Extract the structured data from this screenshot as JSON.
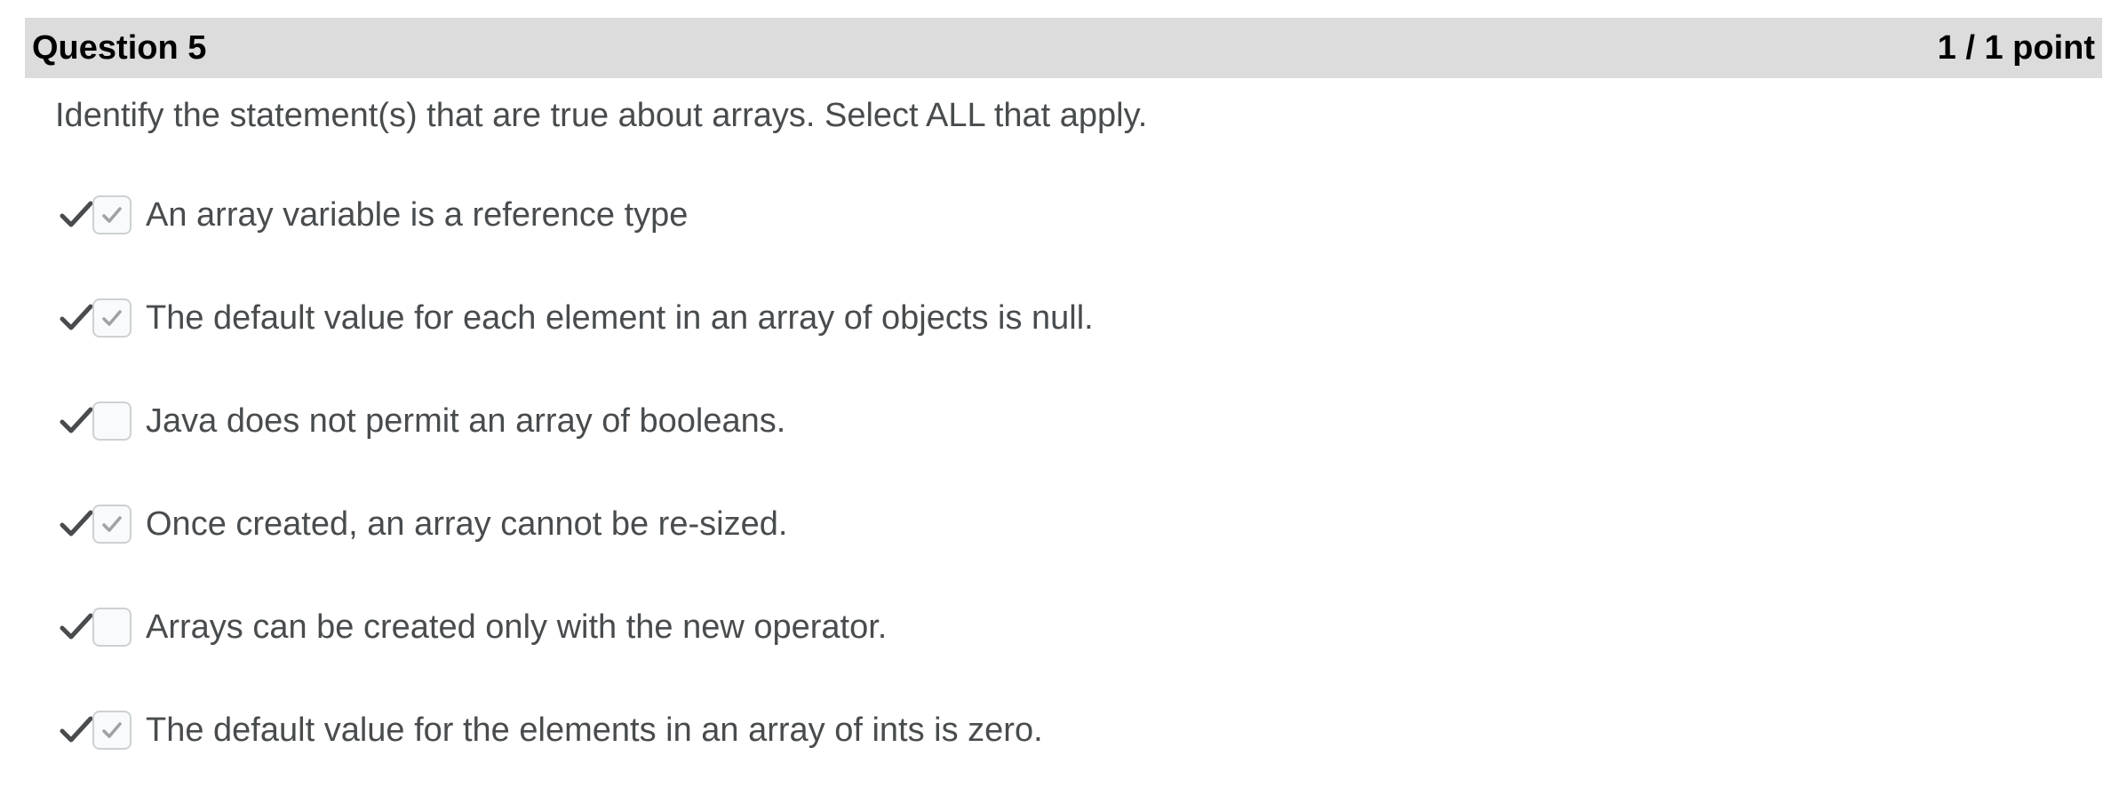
{
  "question": {
    "title": "Question 5",
    "score": "1 / 1 point",
    "prompt": "Identify the statement(s) that are true about arrays. Select ALL that apply."
  },
  "options": [
    {
      "label": "An array variable is a reference type",
      "checked": true,
      "result": "correct"
    },
    {
      "label": "The default value for each element in an array of objects is null.",
      "checked": true,
      "result": "correct"
    },
    {
      "label": "Java does not permit an array of booleans.",
      "checked": false,
      "result": "correct"
    },
    {
      "label": "Once created, an array cannot be re-sized.",
      "checked": true,
      "result": "correct"
    },
    {
      "label": "Arrays can be created only with the new operator.",
      "checked": false,
      "result": "correct"
    },
    {
      "label": "The default value for the elements in an array of ints is zero.",
      "checked": true,
      "result": "correct"
    }
  ],
  "icons": {
    "result": "checkmark-icon",
    "checkbox_check": "checkmark-icon"
  },
  "colors": {
    "header_bg": "#dcdcdc",
    "text": "#494c4e",
    "result_mark": "#494c4e",
    "checkbox_border": "#cdd1d4",
    "checkbox_check": "#9ea2a5"
  }
}
